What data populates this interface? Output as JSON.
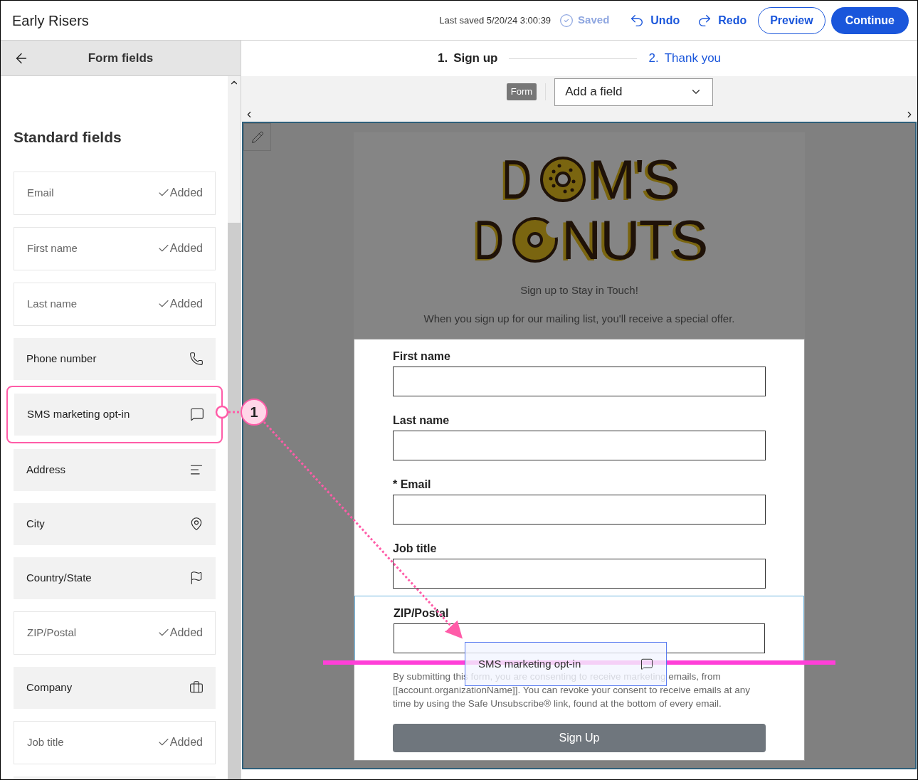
{
  "app": {
    "title": "Early Risers",
    "last_saved": "Last saved 5/20/24 3:00:39",
    "saved": {
      "label": "Saved",
      "disabled": true
    },
    "undo": "Undo",
    "redo": "Redo",
    "preview": "Preview",
    "continue": "Continue"
  },
  "sidebar": {
    "title": "Form fields",
    "section": "Standard fields",
    "items": [
      {
        "label": "Email",
        "kind": "added",
        "status": "Added",
        "highlighted": false
      },
      {
        "label": "First name",
        "kind": "added",
        "status": "Added",
        "highlighted": false
      },
      {
        "label": "Last name",
        "kind": "added",
        "status": "Added",
        "highlighted": false
      },
      {
        "label": "Phone number",
        "kind": "available",
        "highlighted": false
      },
      {
        "label": "SMS marketing opt-in",
        "kind": "available",
        "highlighted": true
      },
      {
        "label": "Address",
        "kind": "available",
        "highlighted": false
      },
      {
        "label": "City",
        "kind": "available",
        "highlighted": false
      },
      {
        "label": "Country/State",
        "kind": "available",
        "highlighted": false
      },
      {
        "label": "ZIP/Postal",
        "kind": "added",
        "status": "Added",
        "highlighted": false
      },
      {
        "label": "Company",
        "kind": "available",
        "highlighted": false
      },
      {
        "label": "Job title",
        "kind": "added",
        "status": "Added",
        "highlighted": false
      }
    ]
  },
  "steps": [
    {
      "number": "1.",
      "label": "Sign up",
      "selected": true
    },
    {
      "number": "2.",
      "label": "Thank you",
      "selected": false
    }
  ],
  "toolbar": {
    "tag": "Form",
    "dropdown": "Add a field"
  },
  "form": {
    "logo": {
      "line_1": [
        "D",
        "M'S"
      ],
      "line_2": [
        "D",
        "NUTS"
      ]
    },
    "heading": "Sign up to Stay in Touch!",
    "intro": "When you sign up for our mailing list, you'll receive a special offer.",
    "fields": [
      {
        "label": "First name",
        "highlighted": false
      },
      {
        "label": "Last name",
        "highlighted": false
      },
      {
        "label": "* Email",
        "highlighted": false
      },
      {
        "label": "Job title",
        "highlighted": false
      },
      {
        "label": "ZIP/Postal",
        "highlighted": true
      }
    ],
    "consent": "By submitting this form, you are consenting to receive marketing emails, from [[account.organizationName]]. You can revoke your consent to receive emails at any time by using the Safe Unsubscribe® link, found at the bottom of every email.",
    "submit": "Sign Up"
  },
  "drag": {
    "label": "SMS marketing opt-in",
    "step": "1"
  }
}
